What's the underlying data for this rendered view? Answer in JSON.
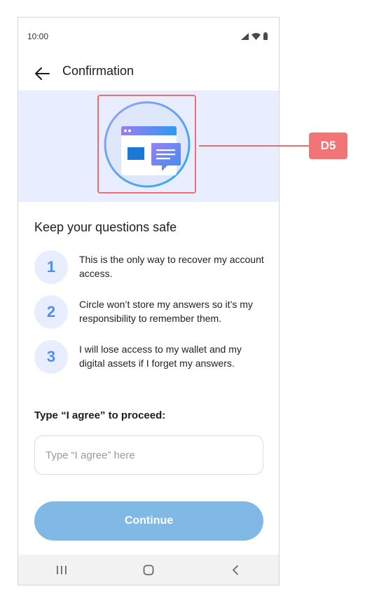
{
  "status_bar": {
    "time": "10:00"
  },
  "app_bar": {
    "title": "Confirmation"
  },
  "content": {
    "heading": "Keep your questions safe",
    "steps": [
      {
        "number": "1",
        "text": "This is the only way to recover my account access."
      },
      {
        "number": "2",
        "text": "Circle won’t store my answers so it’s my responsibility to remember them."
      },
      {
        "number": "3",
        "text": "I will lose access to my wallet and my digital assets if I forget my answers."
      }
    ],
    "prompt": "Type “I agree” to proceed:",
    "input": {
      "placeholder": "Type “I agree” here",
      "value": ""
    },
    "continue_label": "Continue"
  },
  "annotation": {
    "badge": "D5"
  },
  "colors": {
    "accent": "#4f8df0",
    "banner_bg": "#e8eeff",
    "button_disabled": "#80b8e6",
    "annotation_red": "#f27474"
  },
  "icons": {
    "back": "arrow-left-icon",
    "signal": "signal-icon",
    "wifi": "wifi-icon",
    "battery": "battery-icon",
    "illustration": "browser-chat-illustration",
    "nav_recents": "recent-apps-icon",
    "nav_home": "home-icon",
    "nav_back": "back-chevron-icon"
  }
}
